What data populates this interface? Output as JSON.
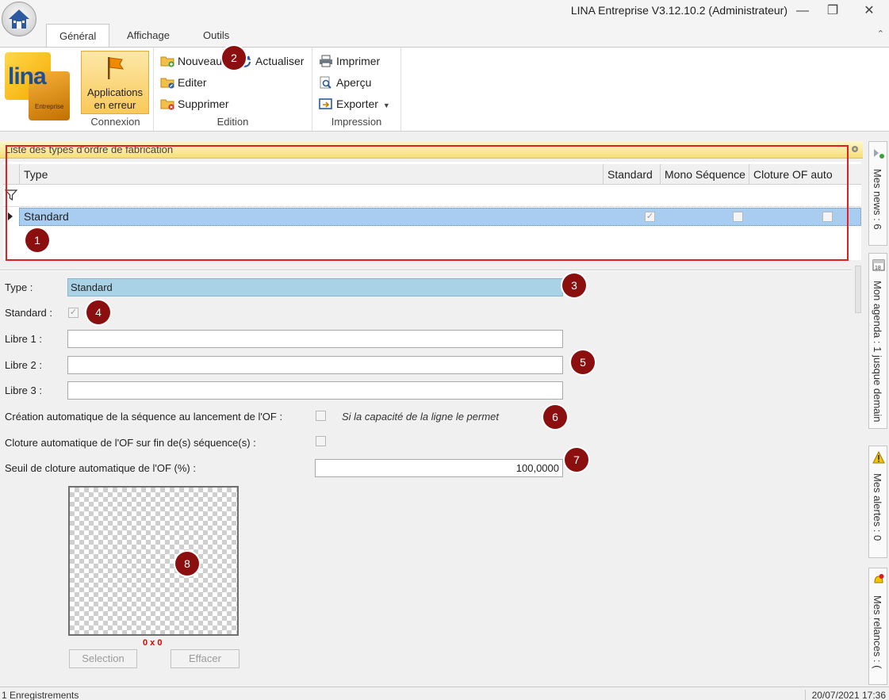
{
  "window": {
    "title": "LINA Entreprise  V3.12.10.2  (Administrateur)"
  },
  "ribbon": {
    "tabs": [
      "Général",
      "Affichage",
      "Outils"
    ],
    "logo": {
      "text": "lina",
      "sub": "Entreprise"
    },
    "groups": {
      "connexion": {
        "label": "Connexion",
        "button": "Applications en erreur"
      },
      "edition": {
        "label": "Edition",
        "nouveau": "Nouveau",
        "actualiser": "Actualiser",
        "editer": "Editer",
        "supprimer": "Supprimer"
      },
      "impression": {
        "label": "Impression",
        "imprimer": "Imprimer",
        "apercu": "Aperçu",
        "exporter": "Exporter"
      }
    }
  },
  "list": {
    "title": "Liste des types d'ordre de fabrication",
    "columns": [
      "Type",
      "Standard",
      "Mono Séquence",
      "Cloture OF auto"
    ],
    "rows": [
      {
        "type": "Standard",
        "standard": true,
        "mono_sequence": false,
        "cloture_of_auto": false
      }
    ]
  },
  "form": {
    "type_label": "Type :",
    "type_value": "Standard",
    "standard_label": "Standard :",
    "standard_checked": true,
    "libre1_label": "Libre 1 :",
    "libre1_value": "",
    "libre2_label": "Libre 2 :",
    "libre2_value": "",
    "libre3_label": "Libre 3 :",
    "libre3_value": "",
    "creation_auto_label": "Création automatique de la séquence au lancement de l'OF :",
    "creation_auto_checked": false,
    "creation_auto_hint": "Si la capacité de la ligne le permet",
    "cloture_auto_label": "Cloture automatique de l'OF sur fin de(s) séquence(s) :",
    "cloture_auto_checked": false,
    "seuil_label": "Seuil de cloture automatique de l'OF (%) :",
    "seuil_value": "100,0000",
    "image_dims": "0 x 0",
    "selection_button": "Selection",
    "effacer_button": "Effacer"
  },
  "side_panel": {
    "news": "Mes news : 6",
    "agenda": "Mon agenda : 1 jusque demain",
    "alertes": "Mes alertes : 0",
    "relances": "Mes relances : ("
  },
  "status": {
    "records": "1 Enregistrements",
    "datetime": "20/07/2021 17:36"
  },
  "callouts": [
    "1",
    "2",
    "3",
    "4",
    "5",
    "6",
    "7",
    "8"
  ],
  "colors": {
    "selection_row": "#a9cdf0",
    "panel_header": "#f7de7a",
    "callout": "#8b0f0f",
    "annotation_frame": "#e02020",
    "type_field": "#a9d2e6"
  },
  "icons": [
    "home-icon",
    "minimize-icon",
    "restore-icon",
    "close-icon",
    "flag-icon",
    "new-folder-icon",
    "refresh-icon",
    "edit-icon",
    "delete-icon",
    "printer-icon",
    "preview-icon",
    "export-icon",
    "filter-icon",
    "news-icon",
    "calendar-icon",
    "alert-icon",
    "reminder-icon"
  ]
}
